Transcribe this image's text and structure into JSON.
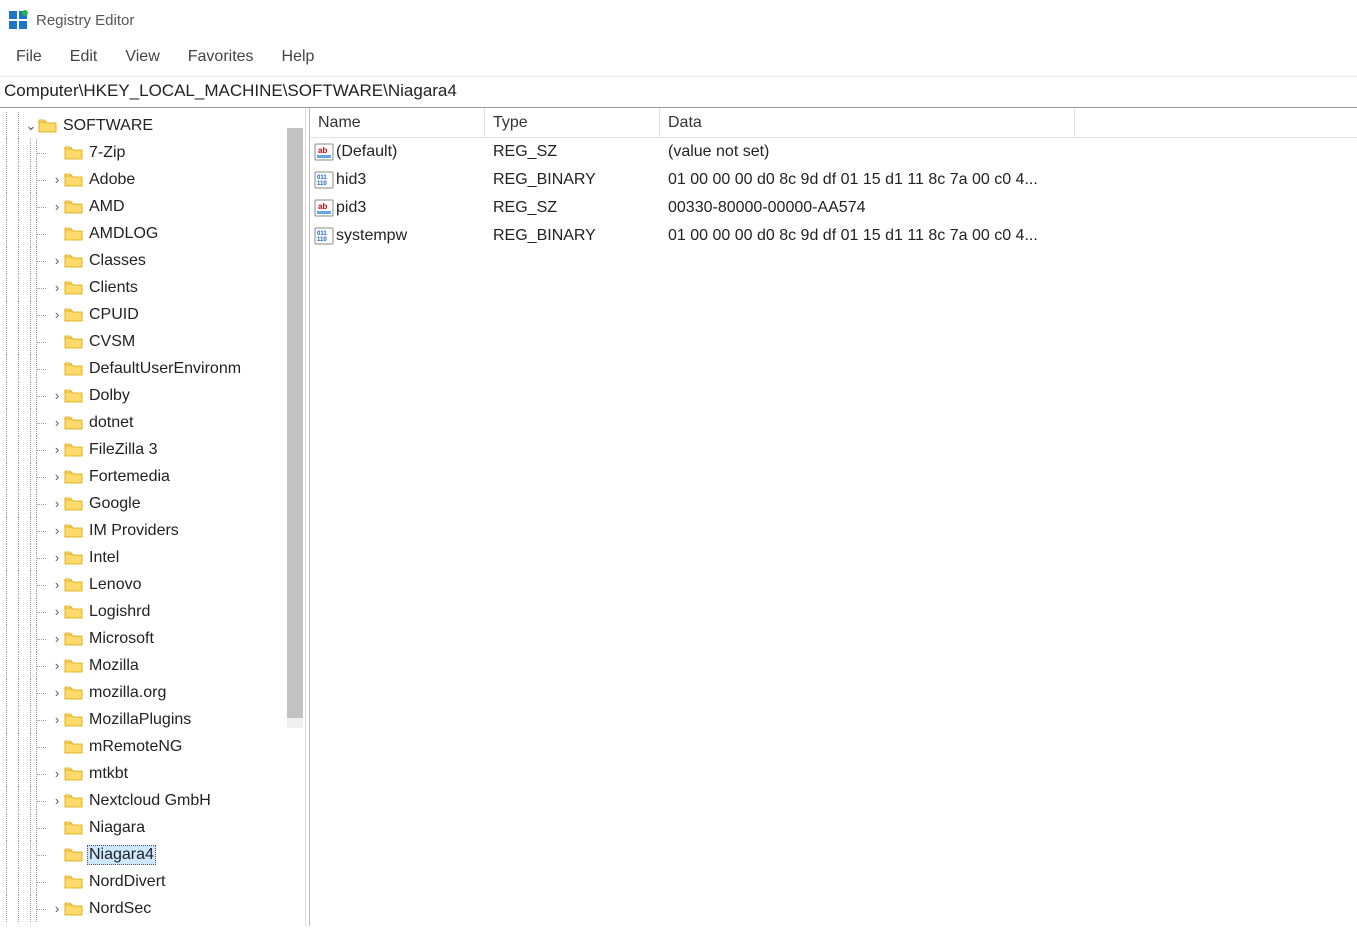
{
  "titlebar": {
    "title": "Registry Editor"
  },
  "menu": {
    "file": "File",
    "edit": "Edit",
    "view": "View",
    "favorites": "Favorites",
    "help": "Help"
  },
  "addressbar": "Computer\\HKEY_LOCAL_MACHINE\\SOFTWARE\\Niagara4",
  "tree": {
    "root_label": "SOFTWARE",
    "nodes": [
      {
        "label": "7-Zip",
        "expandable": false
      },
      {
        "label": "Adobe",
        "expandable": true
      },
      {
        "label": "AMD",
        "expandable": true
      },
      {
        "label": "AMDLOG",
        "expandable": false
      },
      {
        "label": "Classes",
        "expandable": true
      },
      {
        "label": "Clients",
        "expandable": true
      },
      {
        "label": "CPUID",
        "expandable": true
      },
      {
        "label": "CVSM",
        "expandable": false
      },
      {
        "label": "DefaultUserEnvironm",
        "expandable": false
      },
      {
        "label": "Dolby",
        "expandable": true
      },
      {
        "label": "dotnet",
        "expandable": true
      },
      {
        "label": "FileZilla 3",
        "expandable": true
      },
      {
        "label": "Fortemedia",
        "expandable": true
      },
      {
        "label": "Google",
        "expandable": true
      },
      {
        "label": "IM Providers",
        "expandable": true
      },
      {
        "label": "Intel",
        "expandable": true
      },
      {
        "label": "Lenovo",
        "expandable": true
      },
      {
        "label": "Logishrd",
        "expandable": true
      },
      {
        "label": "Microsoft",
        "expandable": true
      },
      {
        "label": "Mozilla",
        "expandable": true
      },
      {
        "label": "mozilla.org",
        "expandable": true
      },
      {
        "label": "MozillaPlugins",
        "expandable": true
      },
      {
        "label": "mRemoteNG",
        "expandable": false
      },
      {
        "label": "mtkbt",
        "expandable": true
      },
      {
        "label": "Nextcloud GmbH",
        "expandable": true
      },
      {
        "label": "Niagara",
        "expandable": false
      },
      {
        "label": "Niagara4",
        "expandable": false,
        "selected": true
      },
      {
        "label": "NordDivert",
        "expandable": false
      },
      {
        "label": "NordSec",
        "expandable": true
      }
    ]
  },
  "list": {
    "headers": {
      "name": "Name",
      "type": "Type",
      "data": "Data"
    },
    "rows": [
      {
        "icon": "sz",
        "name": "(Default)",
        "type": "REG_SZ",
        "data": "(value not set)"
      },
      {
        "icon": "bin",
        "name": "hid3",
        "type": "REG_BINARY",
        "data": "01 00 00 00 d0 8c 9d df 01 15 d1 11 8c 7a 00 c0 4..."
      },
      {
        "icon": "sz",
        "name": "pid3",
        "type": "REG_SZ",
        "data": "00330-80000-00000-AA574"
      },
      {
        "icon": "bin",
        "name": "systempw",
        "type": "REG_BINARY",
        "data": "01 00 00 00 d0 8c 9d df 01 15 d1 11 8c 7a 00 c0 4..."
      }
    ]
  }
}
